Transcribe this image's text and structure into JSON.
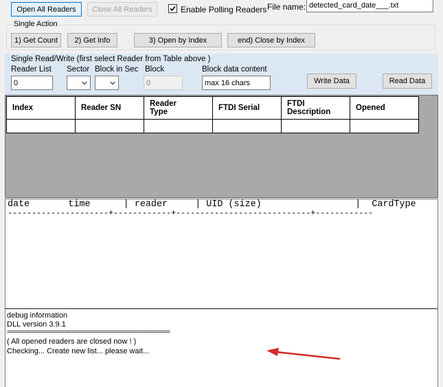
{
  "toolbar": {
    "open_all_label": "Open All Readers",
    "close_all_label": "Close All Readers",
    "polling_label": "Enable Polling Readers",
    "polling_checked": true,
    "file_name_label": "File name:",
    "file_name_value": "detected_card_date___.txt"
  },
  "single_action": {
    "title": "Single Action",
    "get_count_label": "1) Get Count",
    "get_info_label": "2) Get Info",
    "open_by_index_label": "3) Open by Index",
    "close_by_index_label": "end) Close by Index"
  },
  "read_write": {
    "title": "Single Read/Write  (first select Reader from Table above )",
    "reader_list_label": "Reader List",
    "reader_list_value": "0",
    "sector_label": "Sector",
    "block_in_sec_label": "Block in Sec",
    "block_label": "Block",
    "block_value": "0",
    "block_data_label": "Block data content",
    "block_data_value": "max 16 chars",
    "write_label": "Write Data",
    "read_label": "Read Data"
  },
  "reader_table": {
    "columns": [
      {
        "label": "Index"
      },
      {
        "label": "Reader SN"
      },
      {
        "label": "Reader\nType"
      },
      {
        "label": "FTDI Serial"
      },
      {
        "label": "FTDI\nDescription"
      },
      {
        "label": "Opened"
      }
    ]
  },
  "log": {
    "header": "date       time      | reader     | UID (size)                 |  CardType",
    "separator": "---------------------+------------+----------------------------+------------"
  },
  "debug": {
    "lines": [
      "debug information",
      "DLL version 3.9.1",
      "================================================",
      "( All opened readers are closed now ! )",
      "Checking... Create new list... please wait..."
    ]
  },
  "colors": {
    "rw_panel_bg": "#dbe7f3",
    "grid_bg": "#a9a9a9",
    "arrow": "#d42a2a",
    "accent_border": "#0078d7"
  }
}
